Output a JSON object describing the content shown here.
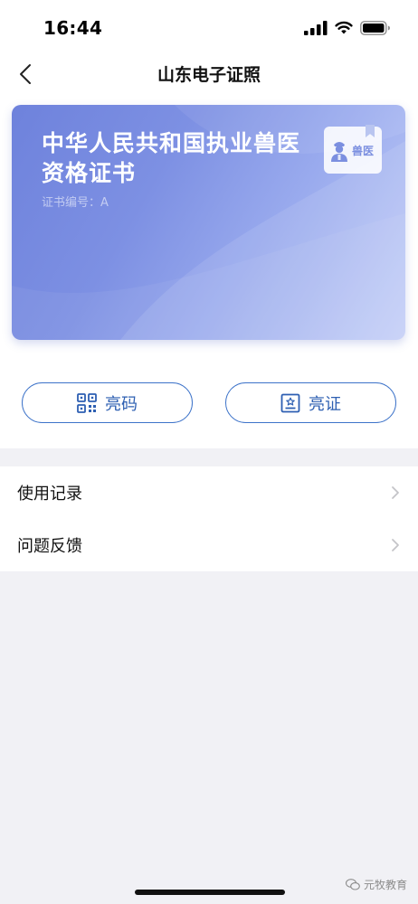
{
  "status_bar": {
    "time": "16:44"
  },
  "nav": {
    "title": "山东电子证照",
    "back_icon": "chevron-left-icon"
  },
  "card": {
    "title": "中华人民共和国执业兽医资格证书",
    "number_label": "证书编号：A",
    "badge_text": "兽医",
    "badge_icon": "veterinarian-person-icon",
    "gradient_start": "#6e82dc",
    "gradient_end": "#c2cdf7"
  },
  "actions": {
    "qr_label": "亮码",
    "qr_icon": "qr-code-icon",
    "cert_label": "亮证",
    "cert_icon": "certificate-icon",
    "accent_color": "#3d73c9"
  },
  "list": {
    "items": [
      {
        "label": "使用记录"
      },
      {
        "label": "问题反馈"
      }
    ]
  },
  "watermark": {
    "text": "元牧教育",
    "icon": "wechat-icon"
  }
}
